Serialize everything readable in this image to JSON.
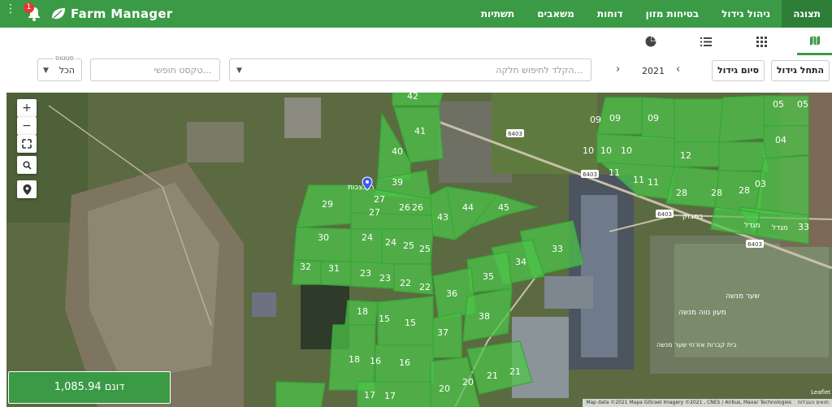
{
  "app": {
    "name": "Farm Manager",
    "notification_count": "1"
  },
  "nav": [
    {
      "label": "תצוגה",
      "active": true
    },
    {
      "label": "ניהול גידול"
    },
    {
      "label": "בטיחות מזון"
    },
    {
      "label": "דוחות"
    },
    {
      "label": "משאבים"
    },
    {
      "label": "תשתיות"
    }
  ],
  "view_tabs": [
    {
      "name": "map-view",
      "icon": "map-icon",
      "active": true
    },
    {
      "name": "grid-view",
      "icon": "grid-icon"
    },
    {
      "name": "list-view",
      "icon": "list-icon"
    },
    {
      "name": "chart-view",
      "icon": "pie-chart-icon"
    }
  ],
  "toolbar": {
    "start_growth": "התחל גידול",
    "end_growth": "סיום גידול",
    "year": "2021",
    "plot_search_placeholder": "הקלד לחיפוש חלקה...",
    "free_text_placeholder": "טקסט חופשי...",
    "status_label": "סטטוס",
    "status_value": "הכל"
  },
  "map": {
    "area_label": "1,085.94 דונם",
    "attribution": "Map data ©2021 Mapa GISrael Imagery ©2021 , CNES / Airbus, Maxar Technologies",
    "terms": "תנאים והגבלות",
    "leaflet": "Leaflet",
    "pin_label": "רגבצכות",
    "roads": [
      "6403",
      "6403",
      "6403",
      "6403"
    ],
    "place_labels": [
      "במבוק",
      "מגדל",
      "מגדל",
      "שער מנשה",
      "מעון נווה מנשה",
      "בית קברות אזרחי שער מנשה"
    ],
    "plots_right": [
      "05",
      "05",
      "09",
      "09",
      "09",
      "04",
      "10",
      "10",
      "10",
      "12",
      "11",
      "11",
      "11",
      "28",
      "28",
      "28",
      "03",
      "33"
    ],
    "plots_left": [
      "42",
      "41",
      "40",
      "39",
      "27",
      "27",
      "26",
      "26",
      "29",
      "43",
      "44",
      "45",
      "30",
      "24",
      "24",
      "25",
      "25",
      "33",
      "32",
      "31",
      "23",
      "23",
      "22",
      "22",
      "34",
      "35",
      "36",
      "38",
      "18",
      "15",
      "15",
      "37",
      "18",
      "16",
      "16",
      "21",
      "21",
      "20",
      "20",
      "17",
      "17"
    ]
  }
}
